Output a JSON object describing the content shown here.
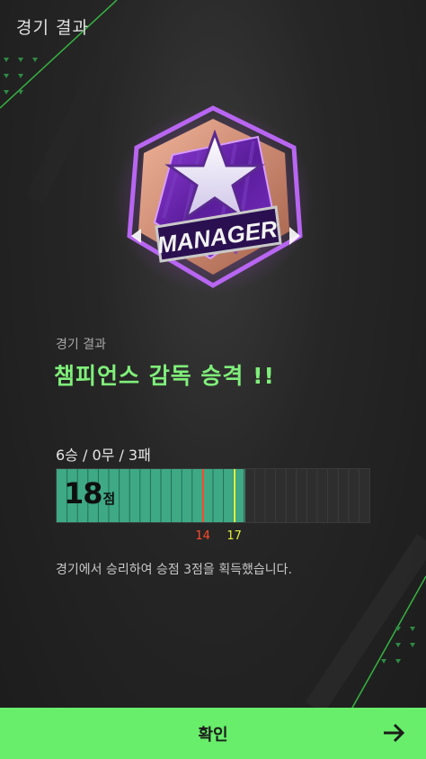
{
  "header": {
    "title": "경기 결과"
  },
  "badge": {
    "label": "MANAGER",
    "icon": "star-icon"
  },
  "result": {
    "section_label": "경기 결과",
    "headline": "챔피언스 감독 승격 !!"
  },
  "record": {
    "text": "6승 / 0무 / 3패"
  },
  "points": {
    "value": "18",
    "unit": "점",
    "current": 18,
    "max": 30,
    "markers": [
      {
        "label": "14",
        "value": 14,
        "color": "#ff4a2e"
      },
      {
        "label": "17",
        "value": 17,
        "color": "#e2ef3d"
      }
    ]
  },
  "description": "경기에서 승리하여 승점 3점을 획득했습니다.",
  "confirm": {
    "label": "확인",
    "icon": "arrow-right-icon"
  },
  "colors": {
    "accent": "#68ee6a",
    "headline": "#7ff07a",
    "bar_fill": "#3fa985"
  }
}
